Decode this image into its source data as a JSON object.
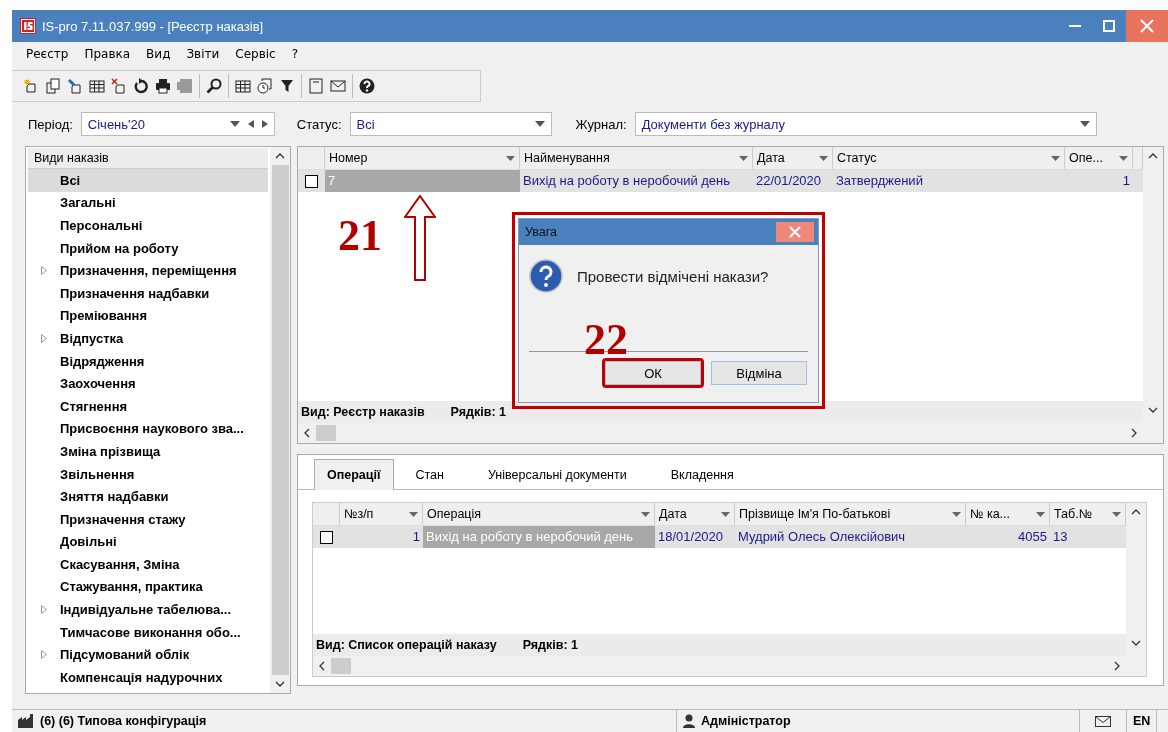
{
  "window": {
    "title": "IS-pro 7.11.037.999 - [Реєстр наказів]"
  },
  "menu": [
    "Реєстр",
    "Правка",
    "Вид",
    "Звіти",
    "Сервіс",
    "?"
  ],
  "filters": [
    {
      "label": "Період:",
      "value": "Січень'20",
      "kind": "period"
    },
    {
      "label": "Статус:",
      "value": "Всі",
      "kind": "combo"
    },
    {
      "label": "Журнал:",
      "value": "Документи без журналу",
      "kind": "combo"
    }
  ],
  "sidebar": {
    "header": "Види наказів",
    "items": [
      {
        "label": "Всі",
        "selected": true,
        "expandable": false
      },
      {
        "label": "Загальні",
        "selected": false,
        "expandable": false
      },
      {
        "label": "Персональні",
        "selected": false,
        "expandable": false
      },
      {
        "label": "Прийом на роботу",
        "selected": false,
        "expandable": false
      },
      {
        "label": "Призначення, переміщення",
        "selected": false,
        "expandable": true
      },
      {
        "label": "Призначення надбавки",
        "selected": false,
        "expandable": false
      },
      {
        "label": "Преміювання",
        "selected": false,
        "expandable": false
      },
      {
        "label": "Відпустка",
        "selected": false,
        "expandable": true
      },
      {
        "label": "Відрядження",
        "selected": false,
        "expandable": false
      },
      {
        "label": "Заохочення",
        "selected": false,
        "expandable": false
      },
      {
        "label": "Стягнення",
        "selected": false,
        "expandable": false
      },
      {
        "label": "Присвоєння наукового зва...",
        "selected": false,
        "expandable": false
      },
      {
        "label": "Зміна прізвища",
        "selected": false,
        "expandable": false
      },
      {
        "label": "Звільнення",
        "selected": false,
        "expandable": false
      },
      {
        "label": "Зняття надбавки",
        "selected": false,
        "expandable": false
      },
      {
        "label": "Призначення стажу",
        "selected": false,
        "expandable": false
      },
      {
        "label": "Довільні",
        "selected": false,
        "expandable": false
      },
      {
        "label": "Скасування, Зміна",
        "selected": false,
        "expandable": false
      },
      {
        "label": "Стажування, практика",
        "selected": false,
        "expandable": false
      },
      {
        "label": "Індивідуальне табелюва...",
        "selected": false,
        "expandable": true
      },
      {
        "label": "Тимчасове виконання обо...",
        "selected": false,
        "expandable": false
      },
      {
        "label": "Підсумований облік",
        "selected": false,
        "expandable": true
      },
      {
        "label": "Компенсація надурочних",
        "selected": false,
        "expandable": false
      }
    ]
  },
  "orders_table": {
    "columns": [
      "Номер",
      "Найменування",
      "Дата",
      "Статус",
      "Опе..."
    ],
    "rows": [
      {
        "checked": false,
        "selected": true,
        "cells": [
          "7",
          "Вихід на роботу в неробочий день",
          "22/01/2020",
          "Затверджений",
          "1"
        ]
      }
    ],
    "view": "Вид: Реєстр наказів",
    "row_count": "Рядків: 1"
  },
  "detail_tabs": [
    {
      "label": "Операції",
      "selected": true
    },
    {
      "label": "Стан",
      "selected": false
    },
    {
      "label": "Універсальні документи",
      "selected": false
    },
    {
      "label": "Вкладення",
      "selected": false
    }
  ],
  "operations_table": {
    "columns": [
      "№з/п",
      "Операція",
      "Дата",
      "Прізвище Ім'я По-батькові",
      "№ ка...",
      "Таб.№"
    ],
    "rows": [
      {
        "checked": false,
        "selected": true,
        "cells": [
          "1",
          "Вихід на роботу в неробочий день",
          "18/01/2020",
          "Мудрий Олесь Олексійович",
          "4055",
          "13"
        ]
      }
    ],
    "view": "Вид: Список операцій наказу",
    "row_count": "Рядків: 1"
  },
  "dialog": {
    "title": "Увага",
    "message": "Провести відмічені накази?",
    "highlighted": true,
    "buttons": [
      {
        "label": "ОК",
        "highlighted": true
      },
      {
        "label": "Відміна",
        "highlighted": false
      }
    ]
  },
  "annotations": [
    {
      "text": "21",
      "kind": "arrow"
    },
    {
      "text": "22",
      "kind": "plain"
    }
  ],
  "status_bar": {
    "config": "(6) (6) Типова конфігурація",
    "user": "Адміністратор",
    "language": "EN"
  }
}
